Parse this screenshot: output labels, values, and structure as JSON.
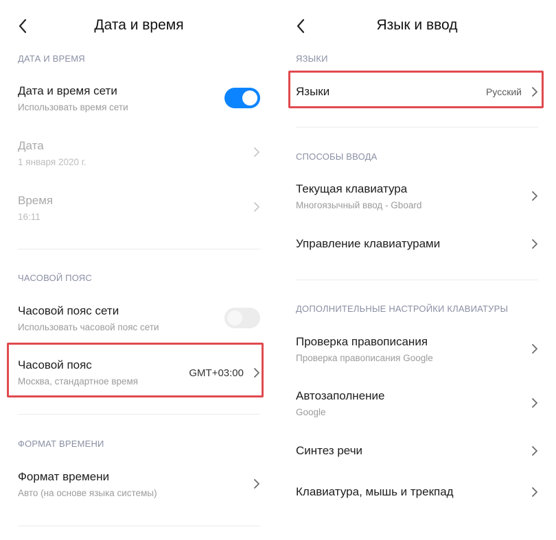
{
  "left": {
    "title": "Дата и время",
    "sections": {
      "date_time": "ДАТА И ВРЕМЯ",
      "timezone": "ЧАСОВОЙ ПОЯС",
      "time_format": "ФОРМАТ ВРЕМЕНИ"
    },
    "items": {
      "network_time": {
        "title": "Дата и время сети",
        "subtitle": "Использовать время сети",
        "toggle": "on"
      },
      "date": {
        "title": "Дата",
        "subtitle": "1 января 2020 г."
      },
      "time": {
        "title": "Время",
        "subtitle": "16:11"
      },
      "network_timezone": {
        "title": "Часовой пояс сети",
        "subtitle": "Использовать часовой пояс сети",
        "toggle": "off"
      },
      "timezone": {
        "title": "Часовой пояс",
        "subtitle": "Москва, стандартное время",
        "value": "GMT+03:00"
      },
      "time_format": {
        "title": "Формат времени",
        "subtitle": "Авто (на основе языка системы)"
      }
    }
  },
  "right": {
    "title": "Язык и ввод",
    "sections": {
      "languages": "ЯЗЫКИ",
      "input_methods": "СПОСОБЫ ВВОДА",
      "advanced_keyboard": "ДОПОЛНИТЕЛЬНЫЕ НАСТРОЙКИ КЛАВИАТУРЫ"
    },
    "items": {
      "languages": {
        "title": "Языки",
        "value": "Русский"
      },
      "current_keyboard": {
        "title": "Текущая клавиатура",
        "subtitle": "Многоязычный ввод - Gboard"
      },
      "manage_keyboards": {
        "title": "Управление клавиатурами"
      },
      "spell_check": {
        "title": "Проверка правописания",
        "subtitle": "Проверка правописания Google"
      },
      "autofill": {
        "title": "Автозаполнение",
        "subtitle": "Google"
      },
      "tts": {
        "title": "Синтез речи"
      },
      "keyboard_mouse": {
        "title": "Клавиатура, мышь и трекпад"
      }
    }
  },
  "colors": {
    "accent": "#0d84ff",
    "highlight": "#e04a4f",
    "section_header": "#8a8fa3"
  },
  "icons": {
    "back": "back-arrow-icon",
    "chevron": "chevron-right-icon"
  }
}
